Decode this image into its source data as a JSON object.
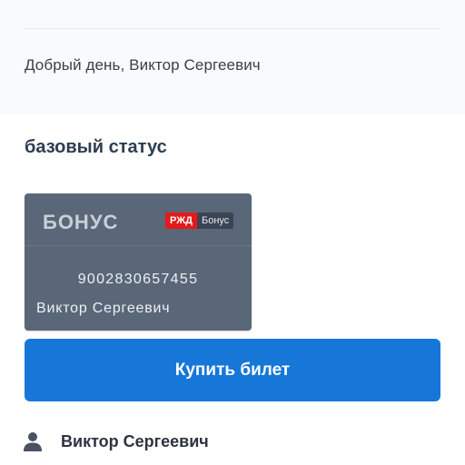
{
  "greeting": "Добрый день, Виктор Сергеевич",
  "status": {
    "title": "базовый статус"
  },
  "card": {
    "logo": "БОНУС",
    "badge_left": "РЖД",
    "badge_right": "Бонус",
    "number": "9002830657455",
    "holder": "Виктор Сергеевич"
  },
  "buy_button": {
    "label": "Купить билет"
  },
  "profile": {
    "name": "Виктор Сергеевич",
    "icon": "user-icon"
  },
  "colors": {
    "primary": "#1677d9",
    "card": "#5a6778",
    "brand_red": "#e21a1a"
  }
}
